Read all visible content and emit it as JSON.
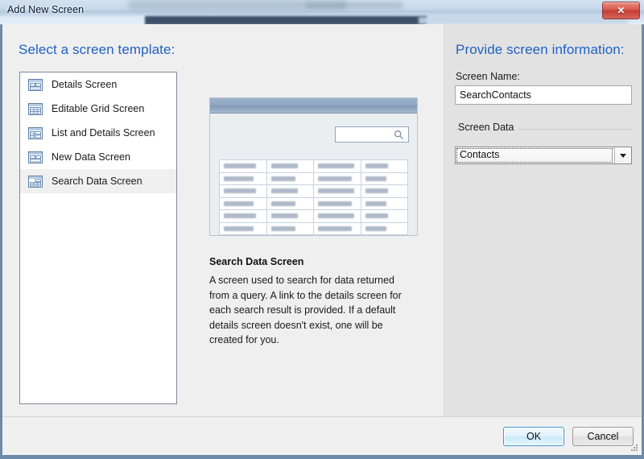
{
  "window": {
    "title": "Add New Screen",
    "close_label": "✕"
  },
  "left": {
    "heading": "Select a screen template:",
    "templates": [
      {
        "label": "Details Screen",
        "icon": "details-screen-icon",
        "selected": false
      },
      {
        "label": "Editable Grid Screen",
        "icon": "editable-grid-screen-icon",
        "selected": false
      },
      {
        "label": "List and Details Screen",
        "icon": "list-and-details-screen-icon",
        "selected": false
      },
      {
        "label": "New Data Screen",
        "icon": "new-data-screen-icon",
        "selected": false
      },
      {
        "label": "Search Data Screen",
        "icon": "search-data-screen-icon",
        "selected": true
      }
    ]
  },
  "preview": {
    "search_icon": "magnifier-icon",
    "grid_columns": 4,
    "grid_rows": 6
  },
  "description": {
    "title": "Search Data Screen",
    "body": "A screen used to search for data returned from a query.  A link to the details screen for each search result is provided.  If a default details screen doesn't exist, one will be created for you."
  },
  "right": {
    "heading": "Provide screen information:",
    "screen_name_label": "Screen Name:",
    "screen_name_value": "SearchContacts",
    "screen_name_placeholder": "",
    "screen_data_group": "Screen Data",
    "screen_data_value": "Contacts"
  },
  "footer": {
    "ok_label": "OK",
    "cancel_label": "Cancel"
  },
  "colors": {
    "heading_blue": "#1f61c4",
    "dialog_bg": "#efefef",
    "right_panel_bg": "#e2e2e2",
    "default_button_border": "#3c99d4",
    "close_button_red": "#c33c33"
  }
}
